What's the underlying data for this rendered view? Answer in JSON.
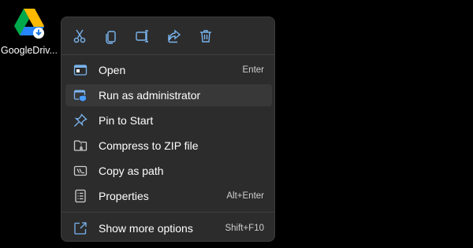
{
  "desktop": {
    "icon_label": "GoogleDriv...",
    "icon_name": "google-drive-icon"
  },
  "menu": {
    "toolbar": [
      {
        "name": "cut-icon"
      },
      {
        "name": "copy-icon"
      },
      {
        "name": "rename-icon"
      },
      {
        "name": "share-icon"
      },
      {
        "name": "delete-icon"
      }
    ],
    "items": [
      {
        "label": "Open",
        "shortcut": "Enter",
        "icon": "open-icon"
      },
      {
        "label": "Run as administrator",
        "shortcut": "",
        "icon": "shield-icon"
      },
      {
        "label": "Pin to Start",
        "shortcut": "",
        "icon": "pin-icon"
      },
      {
        "label": "Compress to ZIP file",
        "shortcut": "",
        "icon": "zip-folder-icon"
      },
      {
        "label": "Copy as path",
        "shortcut": "",
        "icon": "copy-path-icon"
      },
      {
        "label": "Properties",
        "shortcut": "Alt+Enter",
        "icon": "properties-icon"
      }
    ],
    "more": {
      "label": "Show more options",
      "shortcut": "Shift+F10",
      "icon": "more-options-icon"
    }
  },
  "colors": {
    "accent": "#7ab4ef",
    "menu_bg": "#2c2c2c",
    "hover_bg": "#383838"
  }
}
